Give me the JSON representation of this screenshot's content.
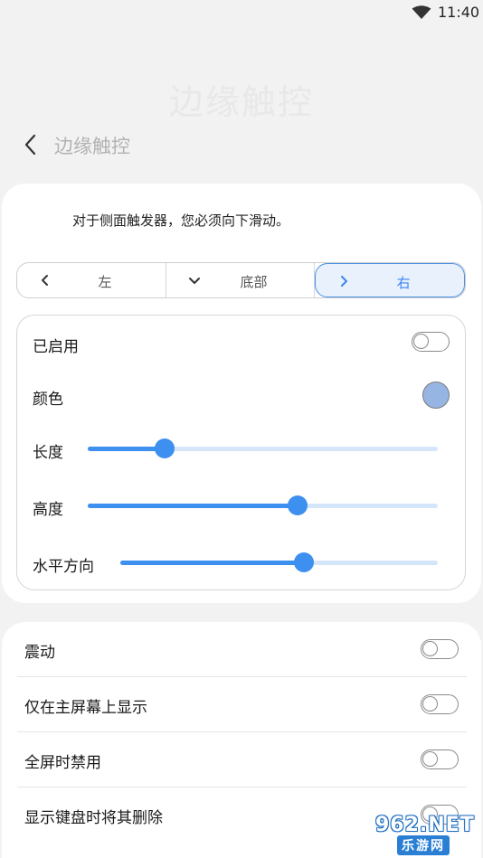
{
  "status_bar": {
    "time": "11:40",
    "wifi_icon": "wifi-icon"
  },
  "page": {
    "big_title": "边缘触控",
    "header_title": "边缘触控",
    "back_icon": "chevron-left-icon"
  },
  "handle": {
    "instruction": "对于侧面触发器，您必须向下滑动。",
    "positions": [
      {
        "label": "左",
        "icon": "chevron-left-icon",
        "selected": false
      },
      {
        "label": "底部",
        "icon": "chevron-down-icon",
        "selected": false
      },
      {
        "label": "右",
        "icon": "chevron-right-icon",
        "selected": true
      }
    ]
  },
  "settings": {
    "enabled_label": "已启用",
    "enabled": false,
    "color_label": "颜色",
    "color_value": "#97b5e3",
    "length_label": "长度",
    "length_value": 0.22,
    "height_label": "高度",
    "height_value": 0.6,
    "horizontal_label": "水平方向",
    "horizontal_value": 0.577,
    "accent_color": "#3d8ff0"
  },
  "options": [
    {
      "label": "震动",
      "enabled": false
    },
    {
      "label": "仅在主屏幕上显示",
      "enabled": false
    },
    {
      "label": "全屏时禁用",
      "enabled": false
    },
    {
      "label": "显示键盘时将其删除",
      "enabled": false
    }
  ],
  "watermark": {
    "text": "962.NET",
    "sub": "乐游网"
  }
}
